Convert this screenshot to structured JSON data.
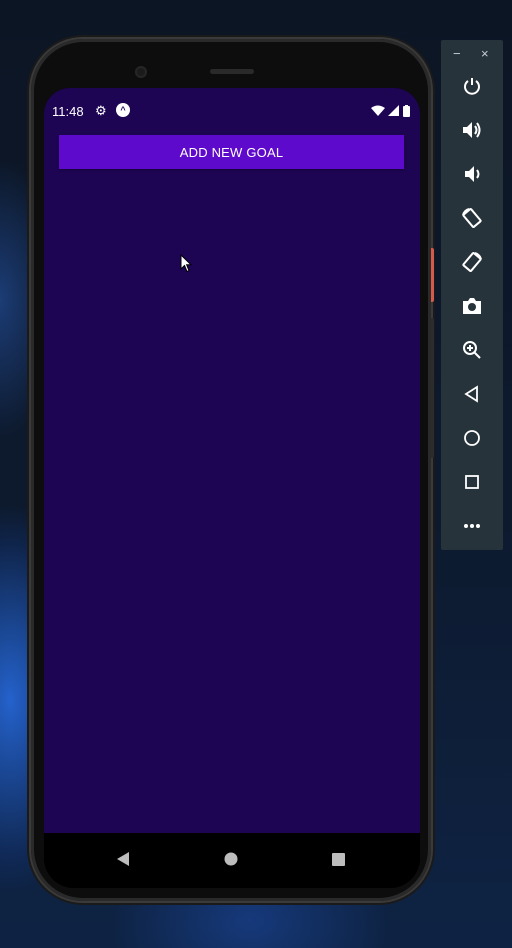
{
  "status_bar": {
    "time": "11:48"
  },
  "app": {
    "add_button_label": "ADD NEW GOAL",
    "background_color": "#1d0553",
    "button_color": "#5e0acc"
  },
  "nav_bar": {
    "icons": [
      "back-icon",
      "home-icon",
      "recents-icon"
    ]
  },
  "emulator_toolbar": {
    "window_controls": [
      "−",
      "×"
    ],
    "icons": [
      "power-icon",
      "volume-up-icon",
      "volume-down-icon",
      "rotate-left-icon",
      "rotate-right-icon",
      "camera-icon",
      "zoom-icon",
      "back-icon",
      "home-icon",
      "overview-icon",
      "more-icon"
    ]
  }
}
